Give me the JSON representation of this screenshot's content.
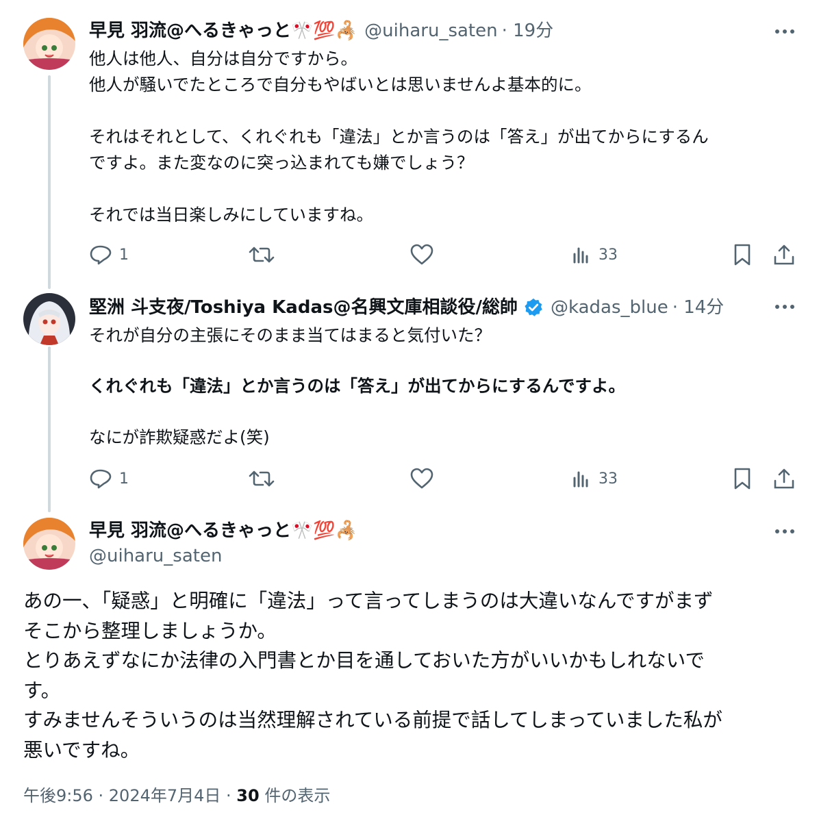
{
  "tweets": [
    {
      "name": "早見 羽流@へるきゃっと🎌💯🦂",
      "handle": "@uiharu_saten",
      "time": "· 19分",
      "lines": "他人は他人、自分は自分ですから。\n他人が騒いでたところで自分もやばいとは思いませんよ基本的に。\n\nそれはそれとして、くれぐれも「違法」とか言うのは「答え」が出てからにするん\nですよ。また変なのに突っ込まれても嫌でしょう？\n\nそれでは当日楽しみにしていますね。",
      "replies": "1",
      "views": "33"
    },
    {
      "name": "堅洲 斗支夜/Toshiya Kadas@名興文庫相談役/総帥",
      "handle": "@kadas_blue",
      "time": "· 14分",
      "line1": "それが自分の主張にそのまま当てはまると気付いた？",
      "bold_line": "くれぐれも「違法」とか言うのは「答え」が出てからにするんですよ。",
      "line3": "なにが詐欺疑惑だよ(笑)",
      "replies": "1",
      "views": "33"
    }
  ],
  "main_tweet": {
    "name": "早見 羽流@へるきゃっと🎌💯🦂",
    "handle": "@uiharu_saten",
    "text": "あの一、「疑惑」と明確に「違法」って言ってしまうのは大違いなんですがまず\nそこから整理しましょうか。\nとりあえずなにか法律の入門書とか目を通しておいた方がいいかもしれないで\nす。\nすみませんそういうのは当然理解されている前提で話してしまっていました私が\n悪いですね。",
    "timestamp": "午後9:56 · 2024年7月4日 · ",
    "view_count": "30",
    "view_label": "件の表示"
  },
  "colors": {
    "accent": "#1d9bf0",
    "muted": "#536471",
    "line": "#cfd9de"
  }
}
